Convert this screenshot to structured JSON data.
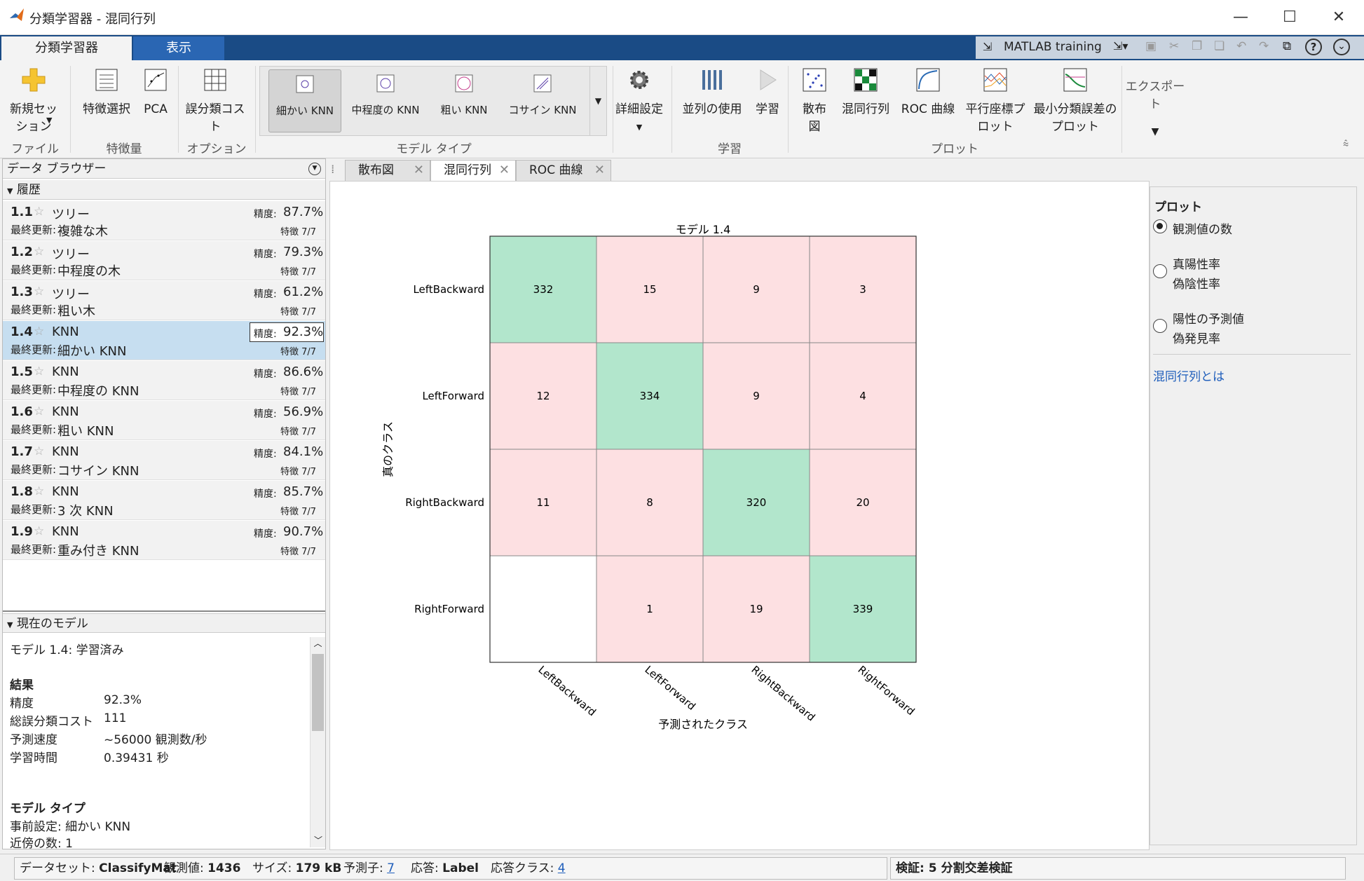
{
  "window": {
    "title": "分類学習器 - 混同行列",
    "minimize": "—",
    "maximize": "☐",
    "close": "✕"
  },
  "tabs": [
    "分類学習器",
    "表示"
  ],
  "qat": {
    "label": "MATLAB training"
  },
  "ribbon": {
    "new_session": "新規セッション",
    "feature_select": "特徴選択",
    "pca": "PCA",
    "misclass_cost": "誤分類コスト",
    "gallery": [
      "細かい KNN",
      "中程度の KNN",
      "粗い KNN",
      "コサイン KNN"
    ],
    "advanced": "詳細設定",
    "parallel": "並列の使用",
    "train": "学習",
    "scatter": "散布図",
    "confusion": "混同行列",
    "roc": "ROC 曲線",
    "parallel_coords": "平行座標プロット",
    "min_err": "最小分類誤差のプロット",
    "export": "エクスポート",
    "sections": {
      "file": "ファイル",
      "features": "特徴量",
      "options": "オプション",
      "model_type": "モデル タイプ",
      "training": "学習",
      "plots": "プロット"
    }
  },
  "data_browser": {
    "title": "データ ブラウザー",
    "history_label": "履歴",
    "current_model_label": "現在のモデル"
  },
  "history": [
    {
      "id": "1.1",
      "type": "ツリー",
      "last_label": "最終更新:",
      "last": "複雑な木",
      "acc_label": "精度:",
      "acc": "87.7%",
      "feat": "特徴 7/7"
    },
    {
      "id": "1.2",
      "type": "ツリー",
      "last_label": "最終更新:",
      "last": "中程度の木",
      "acc_label": "精度:",
      "acc": "79.3%",
      "feat": "特徴 7/7"
    },
    {
      "id": "1.3",
      "type": "ツリー",
      "last_label": "最終更新:",
      "last": "粗い木",
      "acc_label": "精度:",
      "acc": "61.2%",
      "feat": "特徴 7/7"
    },
    {
      "id": "1.4",
      "type": "KNN",
      "last_label": "最終更新:",
      "last": "細かい KNN",
      "acc_label": "精度:",
      "acc": "92.3%",
      "feat": "特徴 7/7"
    },
    {
      "id": "1.5",
      "type": "KNN",
      "last_label": "最終更新:",
      "last": "中程度の KNN",
      "acc_label": "精度:",
      "acc": "86.6%",
      "feat": "特徴 7/7"
    },
    {
      "id": "1.6",
      "type": "KNN",
      "last_label": "最終更新:",
      "last": "粗い KNN",
      "acc_label": "精度:",
      "acc": "56.9%",
      "feat": "特徴 7/7"
    },
    {
      "id": "1.7",
      "type": "KNN",
      "last_label": "最終更新:",
      "last": "コサイン KNN",
      "acc_label": "精度:",
      "acc": "84.1%",
      "feat": "特徴 7/7"
    },
    {
      "id": "1.8",
      "type": "KNN",
      "last_label": "最終更新:",
      "last": "3 次 KNN",
      "acc_label": "精度:",
      "acc": "85.7%",
      "feat": "特徴 7/7"
    },
    {
      "id": "1.9",
      "type": "KNN",
      "last_label": "最終更新:",
      "last": "重み付き KNN",
      "acc_label": "精度:",
      "acc": "90.7%",
      "feat": "特徴 7/7"
    }
  ],
  "current_model": {
    "header": "モデル 1.4: 学習済み",
    "results_label": "結果",
    "rows": [
      {
        "k": "精度",
        "v": "92.3%"
      },
      {
        "k": "総誤分類コスト",
        "v": "111"
      },
      {
        "k": "予測速度",
        "v": "~56000 観測数/秒"
      },
      {
        "k": "学習時間",
        "v": "0.39431 秒"
      }
    ],
    "model_type_label": "モデル タイプ",
    "preset": "事前設定: 細かい KNN",
    "neighbors": "近傍の数: 1"
  },
  "doc_tabs": [
    "散布図",
    "混同行列",
    "ROC 曲線"
  ],
  "chart_data": {
    "type": "heatmap",
    "title": "モデル 1.4",
    "xlabel": "予測されたクラス",
    "ylabel": "真のクラス",
    "classes": [
      "LeftBackward",
      "LeftForward",
      "RightBackward",
      "RightForward"
    ],
    "matrix": [
      [
        332,
        15,
        9,
        3
      ],
      [
        12,
        334,
        9,
        4
      ],
      [
        11,
        8,
        320,
        20
      ],
      [
        null,
        1,
        19,
        339
      ]
    ],
    "colors": {
      "correct": "#b2e6cc",
      "incorrect": "#fde0e2",
      "empty": "#ffffff"
    }
  },
  "plot_options": {
    "title": "プロット",
    "opt1": "観測値の数",
    "opt2a": "真陽性率",
    "opt2b": "偽陰性率",
    "opt3a": "陽性の予測値",
    "opt3b": "偽発見率",
    "link": "混同行列とは"
  },
  "status": {
    "dataset_label": "データセット:",
    "dataset": "ClassifyMat",
    "obs_label": "観測値:",
    "obs": "1436",
    "size_label": "サイズ:",
    "size": "179 kB",
    "pred_label": "予測子:",
    "pred": "7",
    "resp_label": "応答:",
    "resp": "Label",
    "rcls_label": "応答クラス:",
    "rcls": "4",
    "validation": "検証: 5 分割交差検証"
  }
}
